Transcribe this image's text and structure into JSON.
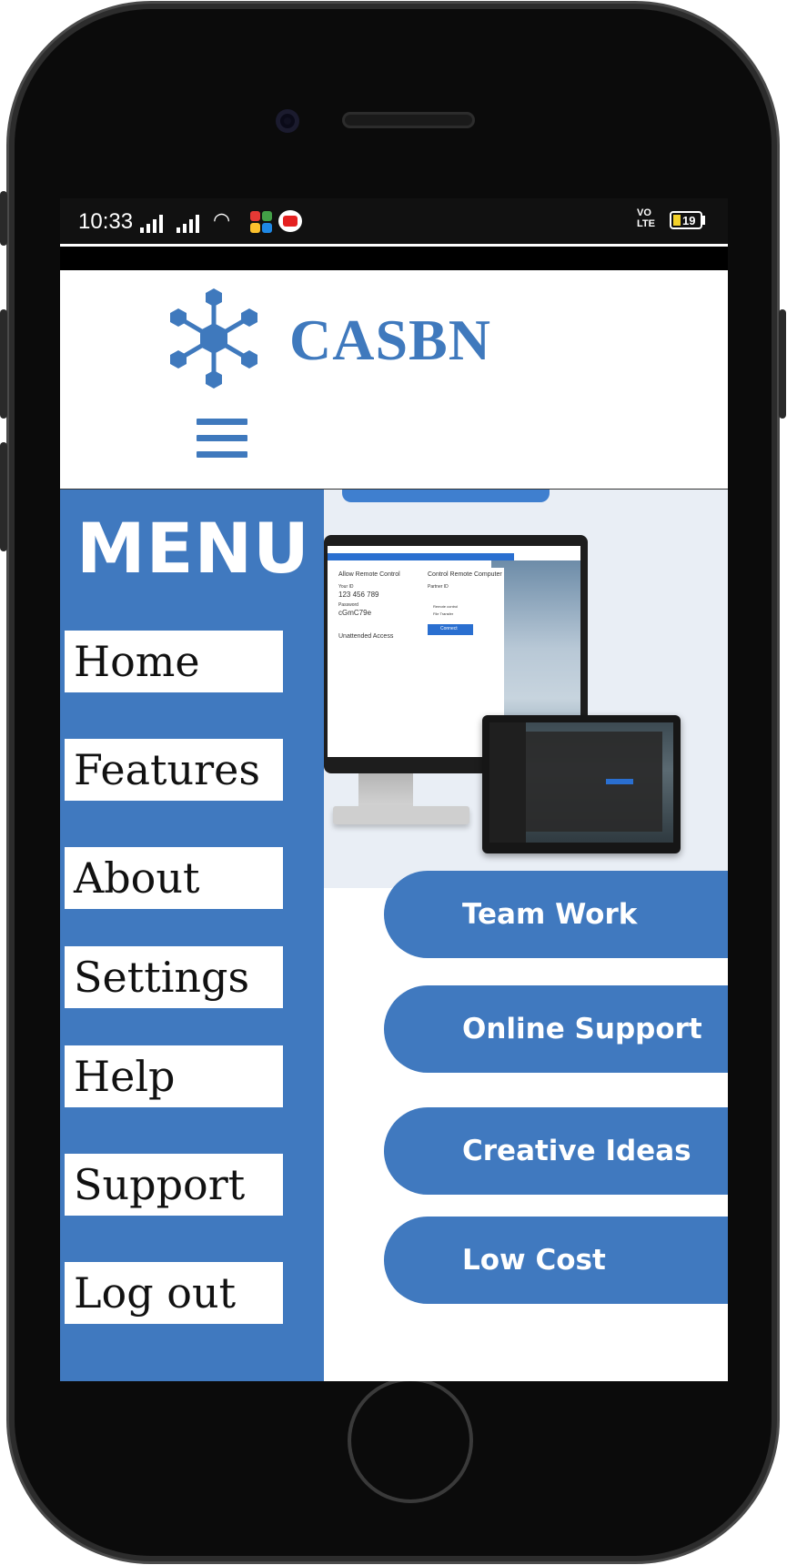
{
  "status_bar": {
    "time": "10:33",
    "network_label": "VO LTE",
    "battery_level": "19"
  },
  "header": {
    "brand": "CASBN",
    "logo_icon": "molecule-network-icon",
    "menu_icon": "hamburger-icon"
  },
  "menu": {
    "title": "MENU",
    "items": [
      {
        "label": "Home"
      },
      {
        "label": "Features"
      },
      {
        "label": "About"
      },
      {
        "label": "Settings"
      },
      {
        "label": "Help"
      },
      {
        "label": "Support"
      },
      {
        "label": "Log out"
      }
    ]
  },
  "hero": {
    "panel_left_title": "Allow Remote Control",
    "your_id_label": "Your ID",
    "your_id": "123 456 789",
    "password_label": "Password",
    "password": "cGmC79e",
    "unattended_label": "Unattended Access",
    "panel_right_title": "Control Remote Computer",
    "partner_id_label": "Partner ID",
    "remote_control_label": "Remote control",
    "file_transfer_label": "File Transfer",
    "connect_label": "Connect"
  },
  "features": [
    {
      "label": "Team Work"
    },
    {
      "label": "Online Support"
    },
    {
      "label": "Creative Ideas"
    },
    {
      "label": "Low Cost"
    }
  ],
  "colors": {
    "accent": "#4079bf",
    "brand": "#3f79bd",
    "background": "#ffffff",
    "phone_body": "#0b0b0b"
  }
}
